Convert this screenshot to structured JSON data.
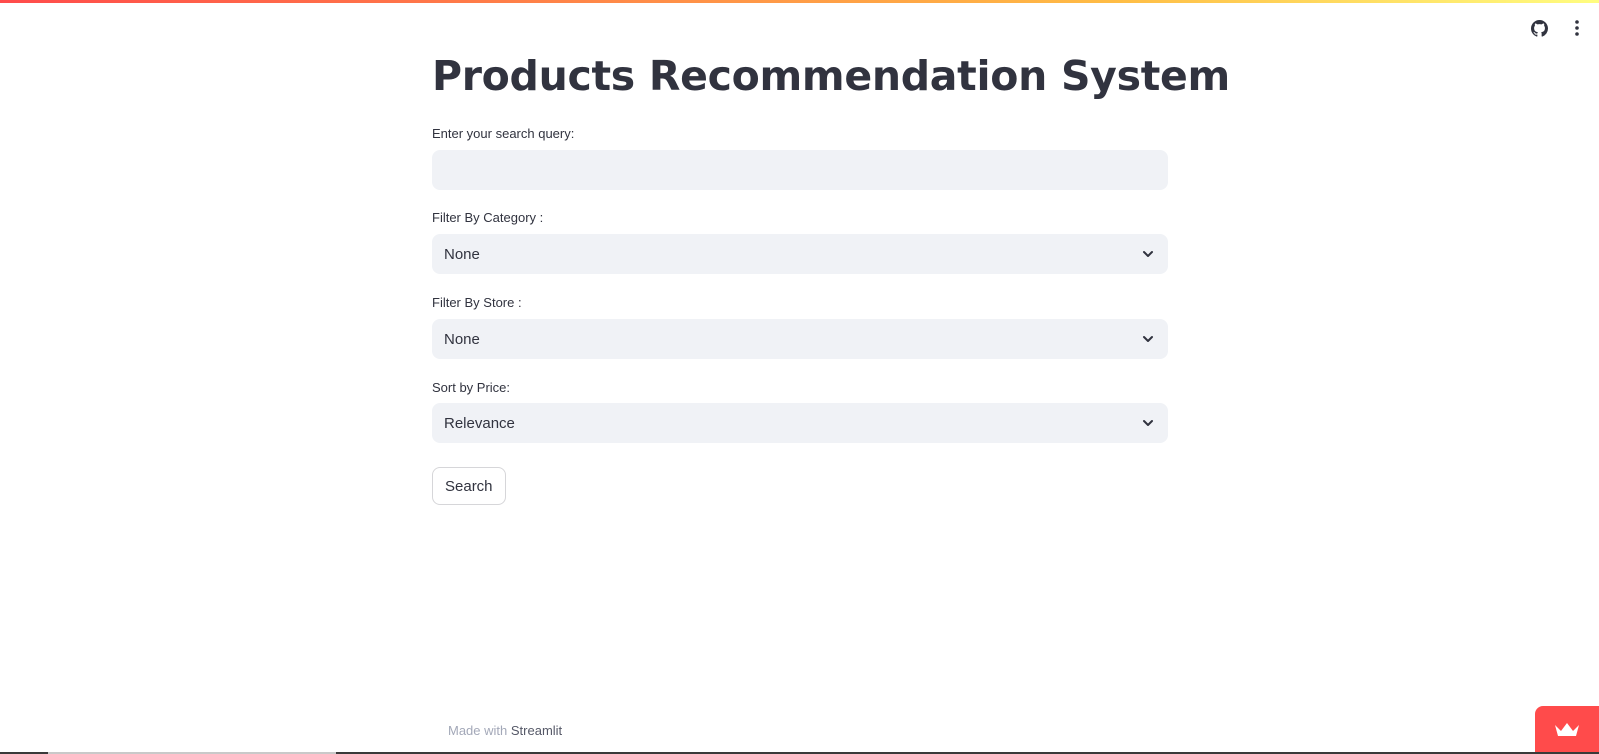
{
  "app": {
    "title": "Products Recommendation System"
  },
  "header": {
    "github_icon": "github-icon",
    "menu_icon": "kebab-menu-icon"
  },
  "form": {
    "search": {
      "label": "Enter your search query:",
      "value": "",
      "placeholder": ""
    },
    "category": {
      "label": "Filter By Category :",
      "selected": "None"
    },
    "store": {
      "label": "Filter By Store :",
      "selected": "None"
    },
    "sort": {
      "label": "Sort by Price:",
      "selected": "Relevance"
    },
    "search_button_label": "Search"
  },
  "footer": {
    "prefix": "Made with ",
    "brand": "Streamlit"
  },
  "colors": {
    "accent": "#ff4b4b",
    "input_bg": "#f0f2f6",
    "text": "#31333f"
  }
}
